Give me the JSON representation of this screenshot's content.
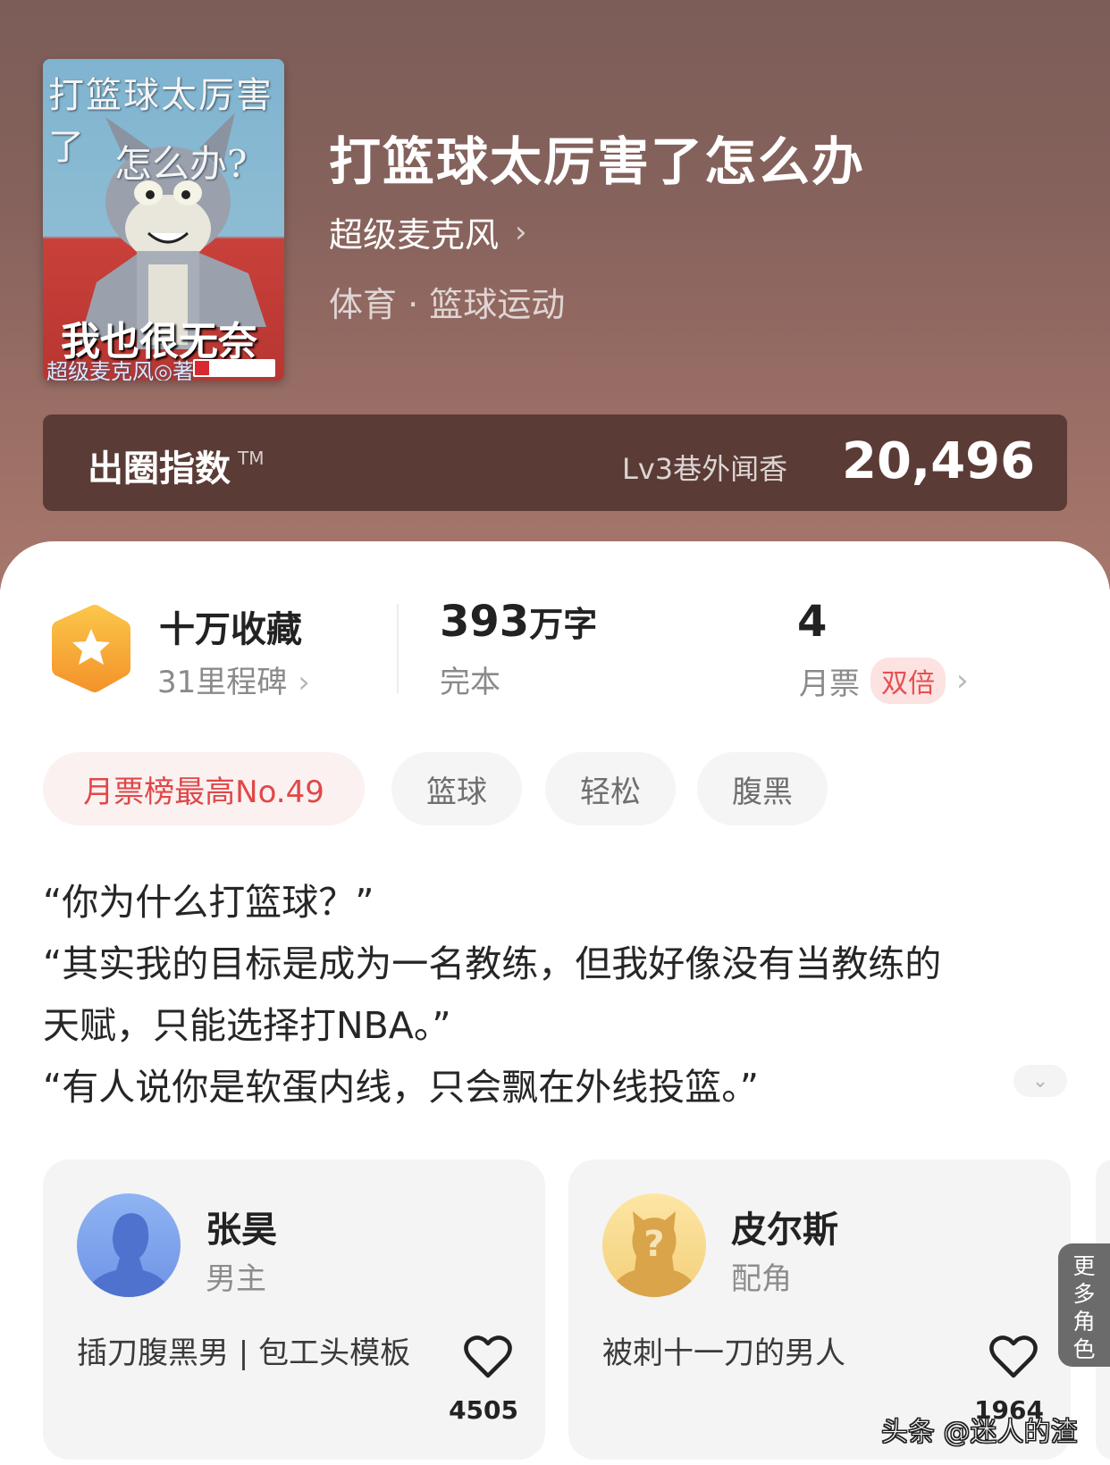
{
  "book": {
    "cover_text_line1": "打篮球太厉害了",
    "cover_text_line2": "怎么办?",
    "cover_text_line3": "我也很无奈啊",
    "cover_text_line4": "超级麦克风◎著",
    "title": "打篮球太厉害了怎么办",
    "author": "超级麦克风",
    "genre": "体育 · 篮球运动"
  },
  "index_bar": {
    "label": "出圈指数",
    "trademark": "TM",
    "level": "Lv3巷外闻香",
    "score": "20,496"
  },
  "stats": {
    "favorites": "十万收藏",
    "milestones": "31里程碑",
    "word_count_number": "393",
    "word_count_unit": "万字",
    "status": "完本",
    "monthly_votes": "4",
    "monthly_votes_label": "月票",
    "double_badge": "双倍"
  },
  "tags": [
    "月票榜最高No.49",
    "篮球",
    "轻松",
    "腹黑"
  ],
  "description": [
    "“你为什么打篮球？”",
    "“其实我的目标是成为一名教练，但我好像没有当教练的",
    "天赋，只能选择打NBA。”",
    "“有人说你是软蛋内线，只会飘在外线投篮。”"
  ],
  "characters": [
    {
      "name": "张昊",
      "role": "男主",
      "desc": "插刀腹黑男 | 包工头模板",
      "likes": "4505"
    },
    {
      "name": "皮尔斯",
      "role": "配角",
      "desc": "被刺十一刀的男人",
      "likes": "1964"
    }
  ],
  "more_roles": [
    "更",
    "多",
    "角",
    "色"
  ],
  "watermark": "头条 @迷人的渣",
  "colors": {
    "hero_bg": "#86625c",
    "index_bar_bg": "#5a3b35",
    "accent_red": "#e04848",
    "badge_orange": "#f5a623"
  }
}
